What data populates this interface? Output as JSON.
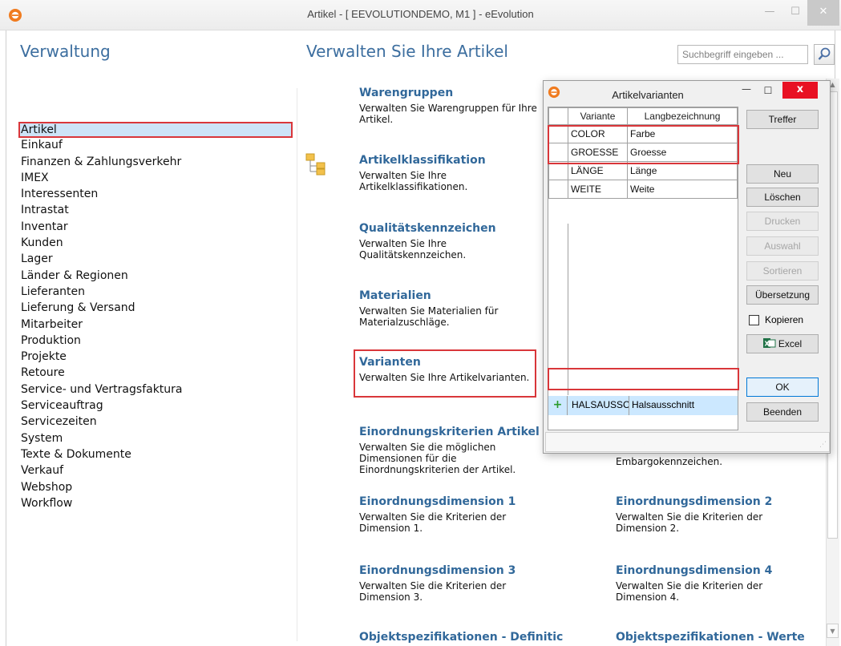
{
  "window": {
    "title": "Artikel - [ EEVOLUTIONDEMO, M1 ]  -  eEvolution",
    "minimize": "—",
    "maximize": "☐",
    "close": "✕"
  },
  "left": {
    "heading": "Verwaltung",
    "items": [
      "Artikel",
      "Einkauf",
      "Finanzen & Zahlungsverkehr",
      "IMEX",
      "Interessenten",
      "Intrastat",
      "Inventar",
      "Kunden",
      "Lager",
      "Länder & Regionen",
      "Lieferanten",
      "Lieferung & Versand",
      "Mitarbeiter",
      "Produktion",
      "Projekte",
      "Retoure",
      "Service- und Vertragsfaktura",
      "Serviceauftrag",
      "Servicezeiten",
      "System",
      "Texte & Dokumente",
      "Verkauf",
      "Webshop",
      "Workflow"
    ],
    "selected": "Artikel"
  },
  "main": {
    "heading": "Verwalten Sie Ihre Artikel",
    "search_placeholder": "Suchbegriff eingeben ...",
    "tiles": [
      {
        "title": "Warengruppen",
        "desc": "Verwalten Sie Warengruppen für Ihre Artikel."
      },
      {
        "title": "Artikelklassifikation",
        "desc": "Verwalten Sie Ihre Artikelklassifikationen."
      },
      {
        "title": "Qualitätskennzeichen",
        "desc": "Verwalten Sie Ihre Qualitätskennzeichen."
      },
      {
        "title": "Materialien",
        "desc": "Verwalten Sie Materialien für Materialzuschläge."
      },
      {
        "title": "Varianten",
        "desc": "Verwalten Sie Ihre Artikelvarianten."
      },
      {
        "title": "Einordnungskriterien Artikel",
        "desc": "Verwalten Sie die möglichen Dimensionen für die Einordnungskriterien der Artikel."
      },
      {
        "title": "",
        "desc": "Embargokennzeichen."
      },
      {
        "title": "Einordnungsdimension 1",
        "desc": "Verwalten Sie die Kriterien der Dimension 1."
      },
      {
        "title": "Einordnungsdimension 2",
        "desc": "Verwalten Sie die Kriterien der Dimension 2."
      },
      {
        "title": "Einordnungsdimension 3",
        "desc": "Verwalten Sie die Kriterien der Dimension 3."
      },
      {
        "title": "Einordnungsdimension 4",
        "desc": "Verwalten Sie die Kriterien der Dimension 4."
      },
      {
        "title": "Objektspezifikationen - Definitic",
        "desc": ""
      },
      {
        "title": "Objektspezifikationen - Werte",
        "desc": ""
      }
    ]
  },
  "dialog": {
    "title": "Artikelvarianten",
    "close": "x",
    "columns": [
      "Variante",
      "Langbezeichnung"
    ],
    "rows": [
      {
        "variante": "COLOR",
        "lang": "Farbe"
      },
      {
        "variante": "GROESSE",
        "lang": "Groesse"
      },
      {
        "variante": "LÄNGE",
        "lang": "Länge"
      },
      {
        "variante": "WEITE",
        "lang": "Weite"
      }
    ],
    "new_row": {
      "variante": "HALSAUSSCHNITT",
      "lang": "Halsausschnitt"
    },
    "buttons": {
      "treffer": "Treffer",
      "neu": "Neu",
      "loeschen": "Löschen",
      "drucken": "Drucken",
      "auswahl": "Auswahl",
      "sortieren": "Sortieren",
      "uebersetzung": "Übersetzung",
      "kopieren": "Kopieren",
      "excel": "Excel",
      "ok": "OK",
      "beenden": "Beenden"
    }
  },
  "colors": {
    "accent": "#3c6e9f",
    "highlight": "#d9363a",
    "selection": "#cde3f7",
    "close": "#e81123"
  }
}
